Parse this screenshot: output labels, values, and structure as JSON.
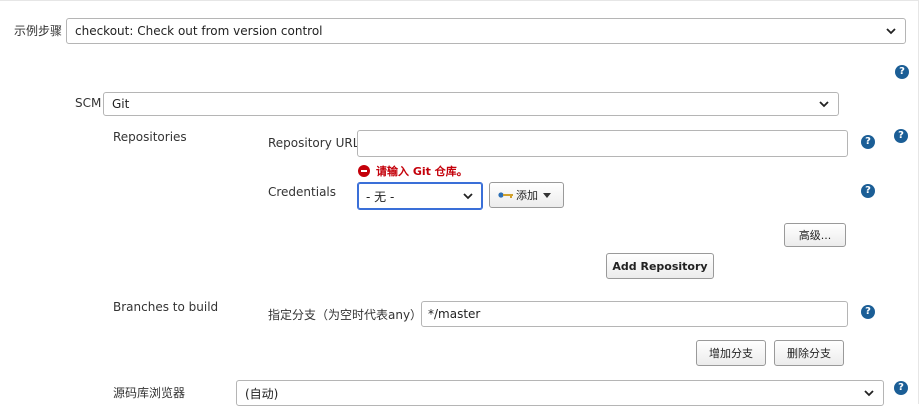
{
  "step": {
    "label": "示例步骤",
    "selected": "checkout: Check out from version control"
  },
  "scm": {
    "label": "SCM",
    "selected": "Git"
  },
  "repositories": {
    "label": "Repositories",
    "url_label": "Repository URL",
    "url_value": "",
    "error_text": "请输入 Git 仓库。",
    "credentials_label": "Credentials",
    "credentials_selected": "- 无 -",
    "add_button": "添加",
    "advanced_button": "高级...",
    "add_repository_button": "Add Repository"
  },
  "branches": {
    "label": "Branches to build",
    "specifier_label": "指定分支（为空时代表any）",
    "specifier_value": "*/master",
    "add_branch_button": "增加分支",
    "delete_branch_button": "删除分支"
  },
  "browser": {
    "label": "源码库浏览器",
    "selected": "(自动)"
  },
  "help_glyph": "?",
  "colors": {
    "help": "#1b5e96",
    "error": "#c4000a",
    "focus": "#3a6fd8"
  }
}
